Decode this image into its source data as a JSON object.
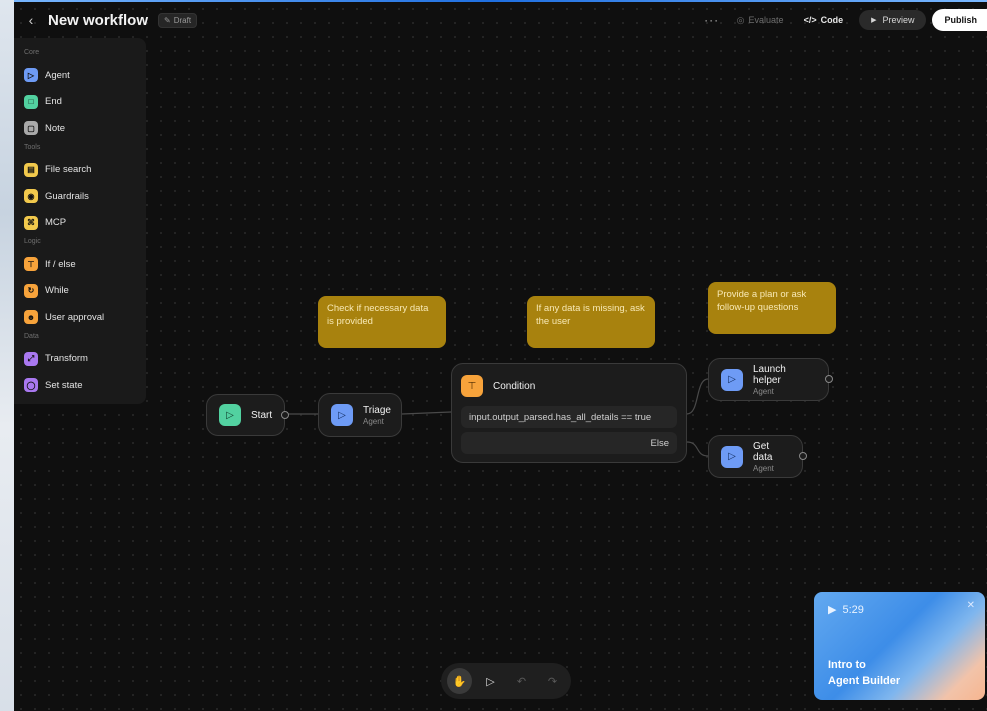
{
  "header": {
    "back_icon": "chevron-left-icon",
    "title": "New workflow",
    "draft_label": "Draft",
    "more_label": "···",
    "evaluate_label": "Evaluate",
    "code_label": "Code",
    "preview_label": "Preview",
    "publish_label": "Publish"
  },
  "sidebar": {
    "sections": [
      {
        "label": "Core",
        "items": [
          {
            "label": "Agent",
            "icon": "agent-icon",
            "color": "#6e9bf5"
          },
          {
            "label": "End",
            "icon": "end-icon",
            "color": "#52d1a0"
          },
          {
            "label": "Note",
            "icon": "note-icon",
            "color": "#a9a9a9"
          }
        ]
      },
      {
        "label": "Tools",
        "items": [
          {
            "label": "File search",
            "icon": "file-search-icon",
            "color": "#f2c94c"
          },
          {
            "label": "Guardrails",
            "icon": "guardrails-icon",
            "color": "#f2c94c"
          },
          {
            "label": "MCP",
            "icon": "mcp-icon",
            "color": "#f2c94c"
          }
        ]
      },
      {
        "label": "Logic",
        "items": [
          {
            "label": "If / else",
            "icon": "if-else-icon",
            "color": "#f7a33b"
          },
          {
            "label": "While",
            "icon": "while-icon",
            "color": "#f7a33b"
          },
          {
            "label": "User approval",
            "icon": "user-approval-icon",
            "color": "#f7a33b"
          }
        ]
      },
      {
        "label": "Data",
        "items": [
          {
            "label": "Transform",
            "icon": "transform-icon",
            "color": "#a978f0"
          },
          {
            "label": "Set state",
            "icon": "set-state-icon",
            "color": "#a978f0"
          }
        ]
      }
    ]
  },
  "nodes": {
    "start": {
      "title": "Start"
    },
    "triage": {
      "title": "Triage",
      "subtitle": "Agent"
    },
    "condition": {
      "title": "Condition",
      "expression": "input.output_parsed.has_all_details == true",
      "else_label": "Else"
    },
    "launch_helper": {
      "title": "Launch helper",
      "subtitle": "Agent"
    },
    "get_data": {
      "title": "Get data",
      "subtitle": "Agent"
    }
  },
  "notes": {
    "note1": "Check if necessary data is provided",
    "note2": "If any data is missing, ask the user",
    "note3": "Provide a plan or ask follow-up questions"
  },
  "video": {
    "duration": "5:29",
    "title_line1": "Intro to",
    "title_line2": "Agent Builder"
  },
  "colors": {
    "agent": "#6e9bf5",
    "start": "#52d1a0",
    "condition": "#f7a33b",
    "note": "#a8820e"
  }
}
